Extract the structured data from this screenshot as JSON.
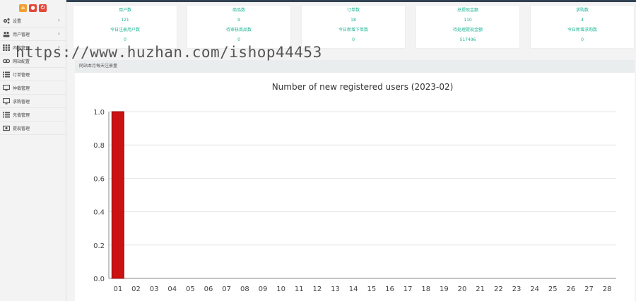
{
  "sidebar": {
    "items": [
      {
        "label": "设置",
        "icon": "gears-icon",
        "has_arrow": true
      },
      {
        "label": "用户管理",
        "icon": "users-icon",
        "has_arrow": true
      },
      {
        "label": "内容管理",
        "icon": "grid-icon",
        "has_arrow": true
      },
      {
        "label": "网站配置",
        "icon": "link-icon",
        "has_arrow": false
      },
      {
        "label": "订单管理",
        "icon": "list-icon",
        "has_arrow": false
      },
      {
        "label": "仲裁管理",
        "icon": "monitor-icon",
        "has_arrow": false
      },
      {
        "label": "求购管理",
        "icon": "monitor-icon",
        "has_arrow": false
      },
      {
        "label": "充值管理",
        "icon": "list-icon",
        "has_arrow": false
      },
      {
        "label": "提现管理",
        "icon": "money-icon",
        "has_arrow": false
      }
    ]
  },
  "stats": [
    {
      "label": "用户数",
      "value": "121",
      "sub_label": "今日注册用户数",
      "sub_value": "0"
    },
    {
      "label": "商品数",
      "value": "9",
      "sub_label": "待审核商品数",
      "sub_value": "0"
    },
    {
      "label": "订单数",
      "value": "18",
      "sub_label": "今日新增下单数",
      "sub_value": "0"
    },
    {
      "label": "总提现金额",
      "value": "110",
      "sub_label": "待处理提现金额",
      "sub_value": "517496"
    },
    {
      "label": "求购数",
      "value": "4",
      "sub_label": "今日新增求购数",
      "sub_value": "0"
    }
  ],
  "panel": {
    "title": "网站本月每天注册量"
  },
  "watermark": "https://www.huzhan.com/ishop44453",
  "colors": {
    "accent": "#1ab394",
    "bar": "#cc1111"
  },
  "chart_data": {
    "type": "bar",
    "title": "Number of new registered users (2023-02)",
    "categories": [
      "01",
      "02",
      "03",
      "04",
      "05",
      "06",
      "07",
      "08",
      "09",
      "10",
      "11",
      "12",
      "13",
      "14",
      "15",
      "16",
      "17",
      "18",
      "19",
      "20",
      "21",
      "22",
      "23",
      "24",
      "25",
      "26",
      "27",
      "28"
    ],
    "values": [
      1,
      0,
      0,
      0,
      0,
      0,
      0,
      0,
      0,
      0,
      0,
      0,
      0,
      0,
      0,
      0,
      0,
      0,
      0,
      0,
      0,
      0,
      0,
      0,
      0,
      0,
      0,
      0
    ],
    "ylim": [
      0,
      1.0
    ],
    "yticks": [
      "0.0",
      "0.2",
      "0.4",
      "0.6",
      "0.8",
      "1.0"
    ],
    "grid": true
  }
}
